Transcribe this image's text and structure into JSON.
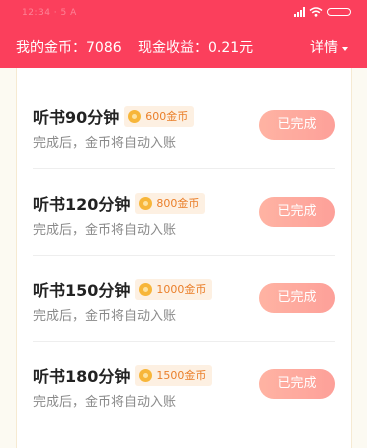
{
  "status_bar": {
    "time": "12:34 · 5 A",
    "signal": "signal-icon",
    "wifi": "wifi-icon",
    "battery": "battery-icon"
  },
  "header": {
    "coins_label": "我的金币：7086",
    "cash_label": "现金收益：0.21元",
    "details_label": "详情"
  },
  "tasks": [
    {
      "title": "听书90分钟",
      "reward": "600金币",
      "desc": "完成后，金币将自动入账",
      "button": "已完成"
    },
    {
      "title": "听书120分钟",
      "reward": "800金币",
      "desc": "完成后，金币将自动入账",
      "button": "已完成"
    },
    {
      "title": "听书150分钟",
      "reward": "1000金币",
      "desc": "完成后，金币将自动入账",
      "button": "已完成"
    },
    {
      "title": "听书180分钟",
      "reward": "1500金币",
      "desc": "完成后，金币将自动入账",
      "button": "已完成"
    }
  ],
  "colors": {
    "header_bg": "#fb3f5c",
    "reward_text": "#ea7f2a",
    "button_bg": "#fda099"
  }
}
